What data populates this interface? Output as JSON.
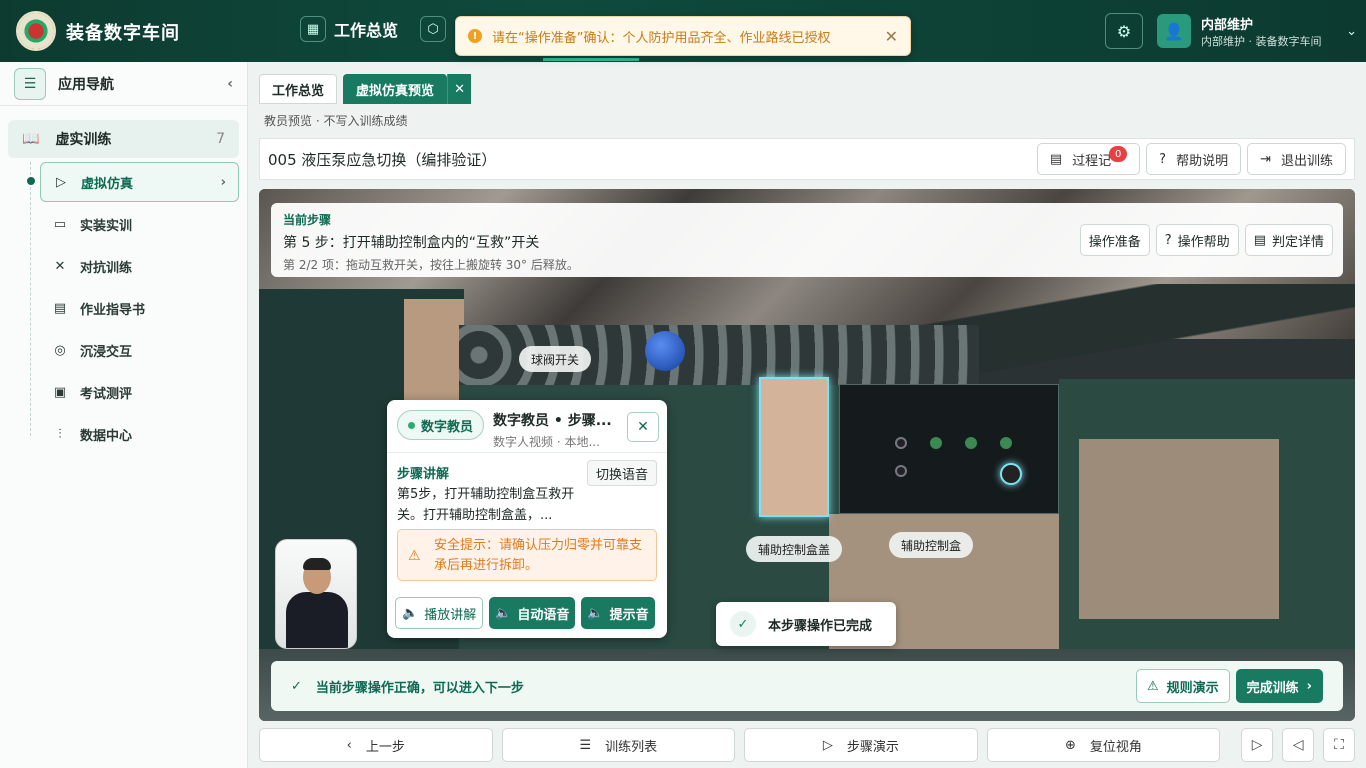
{
  "header": {
    "app_name": "装备数字车间",
    "nav_overview": "工作总览",
    "toast": "请在“操作准备”确认：个人防护用品齐全、作业路线已授权",
    "user_name": "内部维护",
    "user_sub": "内部维护 · 装备数字车间"
  },
  "sidebar": {
    "title": "应用导航",
    "group": {
      "label": "虚实训练",
      "count": "7"
    },
    "items": [
      {
        "label": "虚拟仿真"
      },
      {
        "label": "实装实训"
      },
      {
        "label": "对抗训练"
      },
      {
        "label": "作业指导书"
      },
      {
        "label": "沉浸交互"
      },
      {
        "label": "考试测评"
      },
      {
        "label": "数据中心"
      }
    ]
  },
  "tabs": [
    "工作总览",
    "虚拟仿真预览"
  ],
  "subtitle": "教员预览 · 不写入训练成绩",
  "title_bar": {
    "title": "005 液压泵应急切换（编排验证）",
    "record": "过程记",
    "record_badge": "0",
    "help": "帮助说明",
    "exit": "退出训练"
  },
  "step": {
    "kicker": "当前步骤",
    "title": "第 5 步：打开辅助控制盒内的“互救”开关",
    "sub": "第 2/2 项：拖动互救开关，按往上搬旋转 30° 后释放。",
    "btn_prepare": "操作准备",
    "btn_help": "操作帮助",
    "btn_detail": "判定详情"
  },
  "scene_labels": {
    "ball_valve": "球阀开关",
    "box_cover": "辅助控制盒盖",
    "box": "辅助控制盒"
  },
  "digital_teacher": {
    "tag": "数字教员",
    "head1": "数字教员 • 步骤...",
    "head2": "数字人视频 · 本地...",
    "section": "步骤讲解",
    "switch_voice": "切换语音",
    "text": "第5步，打开辅助控制盒互救开关。打开辅助控制盒盖，...",
    "warning": "安全提示：请确认压力归零并可靠支承后再进行拆卸。",
    "btn_play": "播放讲解",
    "btn_auto": "自动语音",
    "btn_tone": "提示音"
  },
  "step_done": "本步骤操作已完成",
  "ok_bar": {
    "text": "当前步骤操作正确，可以进入下一步",
    "btn_rule": "规则演示",
    "btn_finish": "完成训练"
  },
  "bottom": {
    "prev": "上一步",
    "list": "训练列表",
    "demo": "步骤演示",
    "reset": "复位视角"
  }
}
